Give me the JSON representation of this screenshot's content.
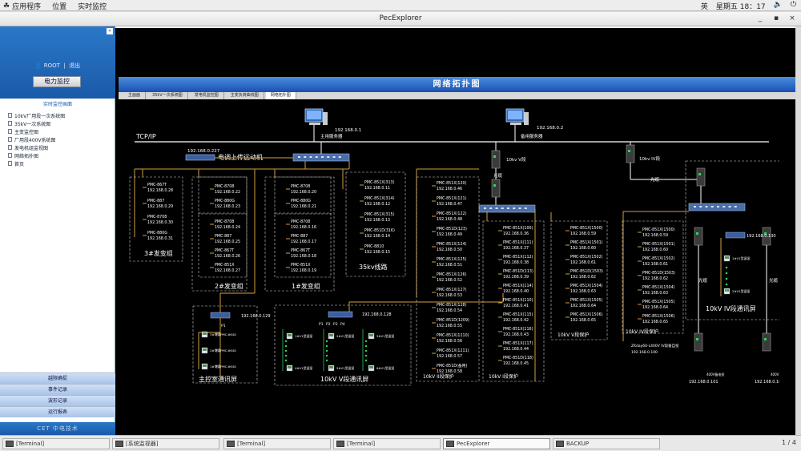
{
  "topbar": {
    "menu": [
      {
        "label": "应用程序"
      },
      {
        "label": "位置"
      },
      {
        "label": "实时监控"
      }
    ],
    "lang": "英",
    "clock": "星期五 18：17"
  },
  "window": {
    "title": "PecExplorer"
  },
  "sidebar": {
    "user": "ROOT",
    "logout": "退出",
    "control_button": "电力监控",
    "section_title": "实时监控画面",
    "tree": [
      {
        "label": "10kV厂用段一次系统图"
      },
      {
        "label": "35kV一次系统图"
      },
      {
        "label": "主变监控图"
      },
      {
        "label": "厂用段400V系统图"
      },
      {
        "label": "发电机组监视图"
      },
      {
        "label": "网络拓扑图"
      },
      {
        "label": "首页"
      }
    ],
    "bottom_buttons": [
      {
        "label": "越限确捉"
      },
      {
        "label": "事件记录"
      },
      {
        "label": "波形记录"
      },
      {
        "label": "运行报表"
      }
    ],
    "logo": "CET 中电技术"
  },
  "main": {
    "banner": "网络拓扑图",
    "tabs": [
      {
        "label": "主画面",
        "active": false
      },
      {
        "label": "35kV一次系统图",
        "active": false
      },
      {
        "label": "发电机监控图",
        "active": false
      },
      {
        "label": "主变负荷曲线图",
        "active": false
      },
      {
        "label": "网络拓扑图",
        "active": true
      }
    ]
  },
  "topology": {
    "bus_label": "TCP/IP",
    "main_server": {
      "ip": "192.168.0.1",
      "label": "主用服务器"
    },
    "backup_server": {
      "ip": "192.168.0.2",
      "label": "备用服务器"
    },
    "dispatch": {
      "ip": "192.168.0.227",
      "label": "电调上传远动机"
    },
    "groups": [
      {
        "title": "3#发变组",
        "devices": [
          {
            "name": "PMC-867T",
            "ip": "192.168.0.28"
          },
          {
            "name": "PMC-887",
            "ip": "192.168.0.29"
          },
          {
            "name": "PMC-8708",
            "ip": "192.168.0.30"
          },
          {
            "name": "PMC-880G",
            "ip": "192.168.0.31"
          }
        ]
      },
      {
        "title": "2#发变组",
        "devices": [
          {
            "name": "PMC-8708",
            "ip": "192.168.0.22"
          },
          {
            "name": "PMC-880G",
            "ip": "192.168.0.23"
          },
          {
            "name": "PMC-8708",
            "ip": "192.168.0.24"
          },
          {
            "name": "PMC-887",
            "ip": "192.168.0.25"
          },
          {
            "name": "PMC-867T",
            "ip": "192.168.0.26"
          },
          {
            "name": "PMC-851X",
            "ip": "192.168.0.27"
          }
        ]
      },
      {
        "title": "1#发变组",
        "devices": [
          {
            "name": "PMC-8708",
            "ip": "192.168.0.20"
          },
          {
            "name": "PMC-880G",
            "ip": "192.168.0.21"
          },
          {
            "name": "PMC-8708",
            "ip": "192.168.0.16"
          },
          {
            "name": "PMC-887",
            "ip": "192.168.0.17"
          },
          {
            "name": "PMC-867T",
            "ip": "192.168.0.18"
          },
          {
            "name": "PMC-851X",
            "ip": "192.168.0.19"
          }
        ]
      },
      {
        "title": "35kv线路",
        "devices": [
          {
            "name": "PMC-851X(313)",
            "ip": "192.168.0.11"
          },
          {
            "name": "PMC-851X(314)",
            "ip": "192.168.0.12"
          },
          {
            "name": "PMC-851X(315)",
            "ip": "192.168.0.13"
          },
          {
            "name": "PMC-851D(316)",
            "ip": "192.168.0.14"
          },
          {
            "name": "PMC-8810",
            "ip": "192.168.0.15"
          }
        ]
      },
      {
        "title": "10kV II段保护",
        "devices": [
          {
            "name": "PMC-851X(120)",
            "ip": "192.168.0.46"
          },
          {
            "name": "PMC-851X(121)",
            "ip": "192.168.0.47"
          },
          {
            "name": "PMC-851X(122)",
            "ip": "192.168.0.48"
          },
          {
            "name": "PMC-851D(123)",
            "ip": "192.168.0.49"
          },
          {
            "name": "PMC-851X(124)",
            "ip": "192.168.0.50"
          },
          {
            "name": "PMC-851X(125)",
            "ip": "192.168.0.51"
          },
          {
            "name": "PMC-851X(126)",
            "ip": "192.168.0.52"
          },
          {
            "name": "PMC-851X(127)",
            "ip": "192.168.0.53"
          },
          {
            "name": "PMC-851X(128)",
            "ip": "192.168.0.54"
          },
          {
            "name": "PMC-851D(1209)",
            "ip": "192.168.0.55"
          },
          {
            "name": "PMC-851X(1210)",
            "ip": "192.168.0.56"
          },
          {
            "name": "PMC-851X(1211)",
            "ip": "192.168.0.57"
          },
          {
            "name": "PMC-851D(备用)",
            "ip": "192.168.0.58"
          }
        ]
      },
      {
        "title": "10kV I段保护",
        "devices": [
          {
            "name": "PMC-851X(100)",
            "ip": "192.168.0.36"
          },
          {
            "name": "PMC-851X(111)",
            "ip": "192.168.0.37"
          },
          {
            "name": "PMC-851X(112)",
            "ip": "192.168.0.38"
          },
          {
            "name": "PMC-851D(113)",
            "ip": "192.168.0.39"
          },
          {
            "name": "PMC-851X(114)",
            "ip": "192.168.0.40"
          },
          {
            "name": "PMC-851X(110)",
            "ip": "192.168.0.41"
          },
          {
            "name": "PMC-851X(115)",
            "ip": "192.168.0.42"
          },
          {
            "name": "PMC-851X(116)",
            "ip": "192.168.0.43"
          },
          {
            "name": "PMC-851X(117)",
            "ip": "192.168.0.44"
          },
          {
            "name": "PMC-851D(118)",
            "ip": "192.168.0.45"
          }
        ]
      },
      {
        "title": "10kV V段保护",
        "devices": [
          {
            "name": "PMC-851X(1500)",
            "ip": "192.168.0.59"
          },
          {
            "name": "PMC-851X(1501)",
            "ip": "192.168.0.60"
          },
          {
            "name": "PMC-851X(1502)",
            "ip": "192.168.0.61"
          },
          {
            "name": "PMC-851D(1503)",
            "ip": "192.168.0.62"
          },
          {
            "name": "PMC-851X(1504)",
            "ip": "192.168.0.63"
          },
          {
            "name": "PMC-851X(1505)",
            "ip": "192.168.0.64"
          },
          {
            "name": "PMC-851X(1506)",
            "ip": "192.168.0.65"
          }
        ]
      },
      {
        "title": "10kV IV段保护",
        "devices": [
          {
            "name": "PMC-851X(1500)",
            "ip": "192.168.0.59"
          },
          {
            "name": "PMC-851X(1501)",
            "ip": "192.168.0.60"
          },
          {
            "name": "PMC-851X(1502)",
            "ip": "192.168.0.61"
          },
          {
            "name": "PMC-851D(1503)",
            "ip": "192.168.0.62"
          },
          {
            "name": "PMC-851X(1504)",
            "ip": "192.168.0.63"
          },
          {
            "name": "PMC-851X(1505)",
            "ip": "192.168.0.64"
          },
          {
            "name": "PMC-851X(1506)",
            "ip": "192.168.0.65"
          }
        ]
      }
    ],
    "ivduan_note": {
      "line1": "ZKday60-L400V IV段备自投",
      "ip": "192.168.0.100"
    },
    "main_screen": {
      "title": "主控室通讯屏",
      "ip": "192.168.0.129",
      "devices": [
        "3#增暖PMC-664G",
        "2#增暖PMC-664G",
        "1#增暖PMC-664G"
      ]
    },
    "v_screen": {
      "title": "10kV V段通讯屏",
      "ip": "192.168.0.128",
      "devices": [
        "1#V1型温湿",
        "2#V1型温湿",
        "3#V1型温湿",
        "4#V1型温湿",
        "5#V1型温湿",
        "6#V1型温湿"
      ]
    },
    "iv_screen": {
      "title": "10kV IV段通讯屏",
      "ip": "192.168.0.130",
      "devices": [
        "1#V1型温湿",
        "2#V1型温湿"
      ]
    },
    "v_switch": {
      "label": "10kv V段"
    },
    "iv_switch": {
      "label": "10kv IV段"
    },
    "cable_v": "光缆",
    "cable_iv": "光缆",
    "cable_l": "光缆",
    "cable_r": "光缆",
    "end_left": {
      "label": "400V备电投",
      "ip": "192.168.0.101"
    },
    "end_right": {
      "label": "400V1号备电投",
      "ip": "192.168.0.102"
    },
    "port_labels": [
      "P1",
      "P2",
      "P3",
      "P4"
    ]
  },
  "taskbar": {
    "items": [
      {
        "label": "[Terminal]",
        "active": false
      },
      {
        "label": "[系统监视器]",
        "active": false
      },
      {
        "label": "[Terminal]",
        "active": false
      },
      {
        "label": "[Terminal]",
        "active": false
      },
      {
        "label": "PecExplorer",
        "active": true
      },
      {
        "label": "BACKUP",
        "active": false
      }
    ],
    "pager": "1 / 4"
  }
}
